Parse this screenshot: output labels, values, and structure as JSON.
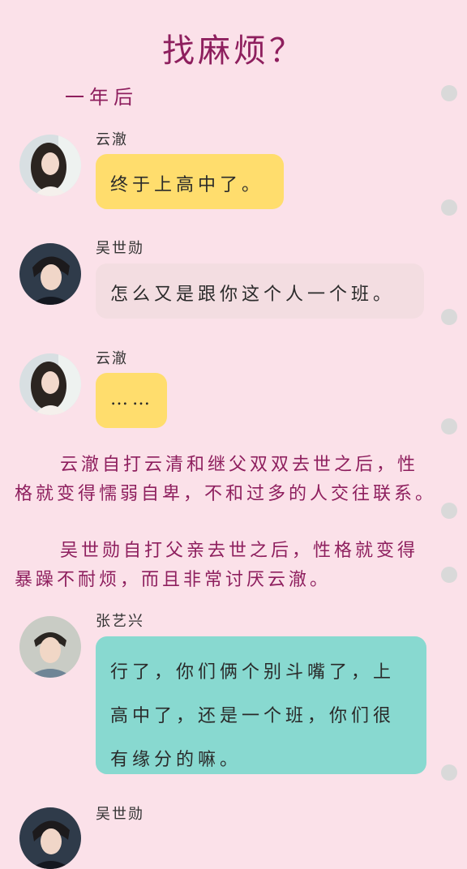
{
  "title": "找麻烦？",
  "subtitle": "一年后",
  "colors": {
    "background": "#fbe1e9",
    "narration": "#8e1f5e",
    "yellow_bubble": "#ffdd6d",
    "pink_bubble": "#f3dde1",
    "teal_bubble": "#88d9d0"
  },
  "messages": [
    {
      "name": "云澈",
      "text": "终于上高中了。",
      "avatar": "girl-avatar"
    },
    {
      "name": "吴世勋",
      "text": "怎么又是跟你这个人一个班。",
      "avatar": "boy-avatar"
    },
    {
      "name": "云澈",
      "text": "……",
      "avatar": "girl-avatar"
    },
    {
      "name": "张艺兴",
      "text": "行了，你们俩个别斗嘴了，上高中了，还是一个班，你们很有缘分的嘛。",
      "avatar": "boy-avatar"
    },
    {
      "name": "吴世勋",
      "avatar": "boy-avatar"
    }
  ],
  "narration": [
    "云澈自打云清和继父双双去世之后，性格就变得懦弱自卑，不和过多的人交往联系。",
    "吴世勋自打父亲去世之后，性格就变得暴躁不耐烦，而且非常讨厌云澈。"
  ]
}
